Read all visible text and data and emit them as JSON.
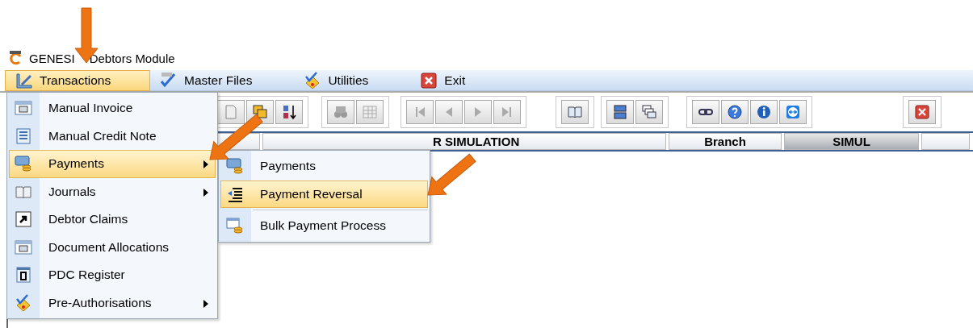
{
  "window": {
    "title_parts": [
      "GENESI",
      "Debtors Module"
    ]
  },
  "menubar": [
    {
      "label": "Transactions",
      "selected": true
    },
    {
      "label": "Master Files",
      "selected": false
    },
    {
      "label": "Utilities",
      "selected": false
    },
    {
      "label": "Exit",
      "selected": false
    }
  ],
  "grid_header": [
    {
      "selected": false
    },
    {
      "label": "R SIMULATION",
      "selected": false
    },
    {
      "label": "Branch",
      "selected": false
    },
    {
      "label": "SIMUL",
      "selected": true
    },
    {
      "selected": false
    }
  ],
  "menu": [
    {
      "label": "Manual Invoice",
      "submenu": false,
      "selected": false
    },
    {
      "label": "Manual Credit Note",
      "submenu": false,
      "selected": false
    },
    {
      "label": "Payments",
      "submenu": true,
      "selected": true
    },
    {
      "label": "Journals",
      "submenu": true,
      "selected": false
    },
    {
      "label": "Debtor Claims",
      "submenu": false,
      "selected": false
    },
    {
      "label": "Document Allocations",
      "submenu": false,
      "selected": false
    },
    {
      "label": "PDC Register",
      "submenu": false,
      "selected": false
    },
    {
      "label": "Pre-Authorisations",
      "submenu": true,
      "selected": false
    }
  ],
  "submenu": [
    {
      "label": "Payments",
      "selected": false
    },
    {
      "label": "Payment Reversal",
      "selected": true
    },
    {
      "label": "Bulk Payment Process",
      "selected": false
    }
  ]
}
